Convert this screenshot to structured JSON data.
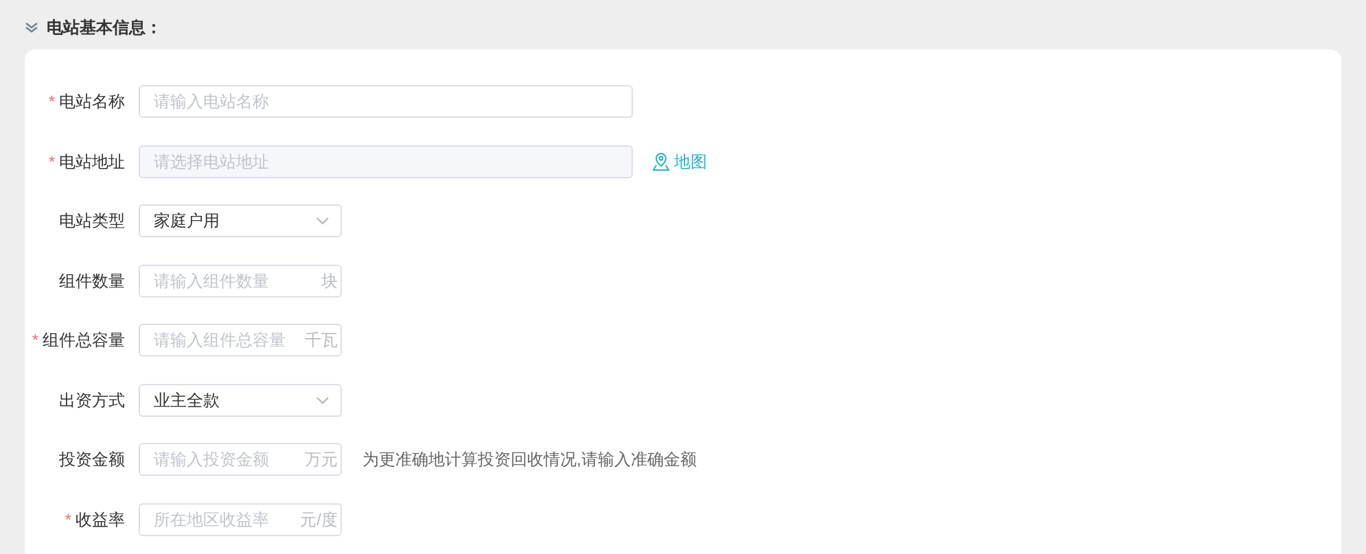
{
  "section": {
    "title": "电站基本信息：",
    "expanded": true
  },
  "required_mark": "*",
  "fields": [
    {
      "kind": "text",
      "label": "电站名称",
      "required": true,
      "placeholder": "请输入电站名称",
      "disabled": false
    },
    {
      "kind": "text",
      "label": "电站地址",
      "required": true,
      "placeholder": "请选择电站地址",
      "disabled": true,
      "link": "地图"
    },
    {
      "kind": "select",
      "label": "电站类型",
      "required": false,
      "value": "家庭户用"
    },
    {
      "kind": "unit",
      "label": "组件数量",
      "required": false,
      "placeholder": "请输入组件数量",
      "unit": "块"
    },
    {
      "kind": "unit",
      "label": "组件总容量",
      "required": true,
      "placeholder": "请输入组件总容量",
      "unit": "千瓦"
    },
    {
      "kind": "select",
      "label": "出资方式",
      "required": false,
      "value": "业主全款"
    },
    {
      "kind": "unit",
      "label": "投资金额",
      "required": false,
      "placeholder": "请输入投资金额",
      "unit": "万元",
      "hint": "为更准确地计算投资回收情况,请输入准确金额"
    },
    {
      "kind": "unit",
      "label": "收益率",
      "required": true,
      "placeholder": "所在地区收益率",
      "unit": "元/度"
    }
  ]
}
